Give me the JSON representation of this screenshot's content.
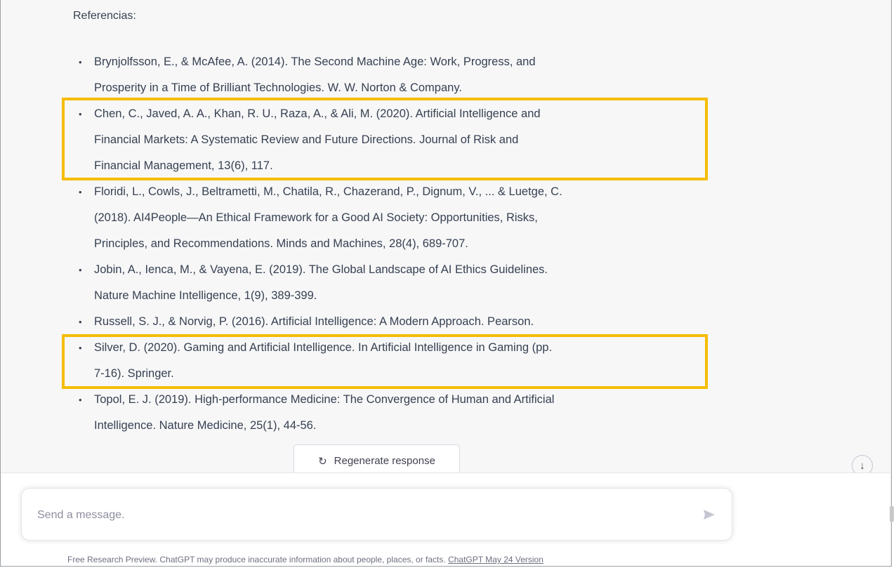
{
  "references": {
    "heading": "Referencias:",
    "items": [
      {
        "lines": [
          "Brynjolfsson, E., & McAfee, A. (2014). The Second Machine Age: Work, Progress, and",
          "Prosperity in a Time of Brilliant Technologies. W. W. Norton & Company."
        ]
      },
      {
        "lines": [
          "Chen, C., Javed, A. A., Khan, R. U., Raza, A., & Ali, M. (2020). Artificial Intelligence and",
          "Financial Markets: A Systematic Review and Future Directions. Journal of Risk and",
          "Financial Management, 13(6), 117."
        ]
      },
      {
        "lines": [
          "Floridi, L., Cowls, J., Beltrametti, M., Chatila, R., Chazerand, P., Dignum, V., ... & Luetge, C.",
          "(2018). AI4People—An Ethical Framework for a Good AI Society: Opportunities, Risks,",
          "Principles, and Recommendations. Minds and Machines, 28(4), 689-707."
        ]
      },
      {
        "lines": [
          "Jobin, A., Ienca, M., & Vayena, E. (2019). The Global Landscape of AI Ethics Guidelines.",
          "Nature Machine Intelligence, 1(9), 389-399."
        ]
      },
      {
        "lines": [
          "Russell, S. J., & Norvig, P. (2016). Artificial Intelligence: A Modern Approach. Pearson."
        ]
      },
      {
        "lines": [
          "Silver, D. (2020). Gaming and Artificial Intelligence. In Artificial Intelligence in Gaming (pp.",
          "7-16). Springer."
        ]
      },
      {
        "lines": [
          "Topol, E. J. (2019). High-performance Medicine: The Convergence of Human and Artificial",
          "Intelligence. Nature Medicine, 25(1), 44-56."
        ]
      }
    ]
  },
  "highlight_color": "#f5bd00",
  "regenerate": {
    "label": "Regenerate response",
    "icon": "refresh-icon"
  },
  "scroll_button": {
    "icon": "arrow-down-icon"
  },
  "composer": {
    "placeholder": "Send a message.",
    "send_icon": "send-icon"
  },
  "footer": {
    "text": "Free Research Preview. ChatGPT may produce inaccurate information about people, places, or facts. ",
    "link": "ChatGPT May 24 Version"
  }
}
